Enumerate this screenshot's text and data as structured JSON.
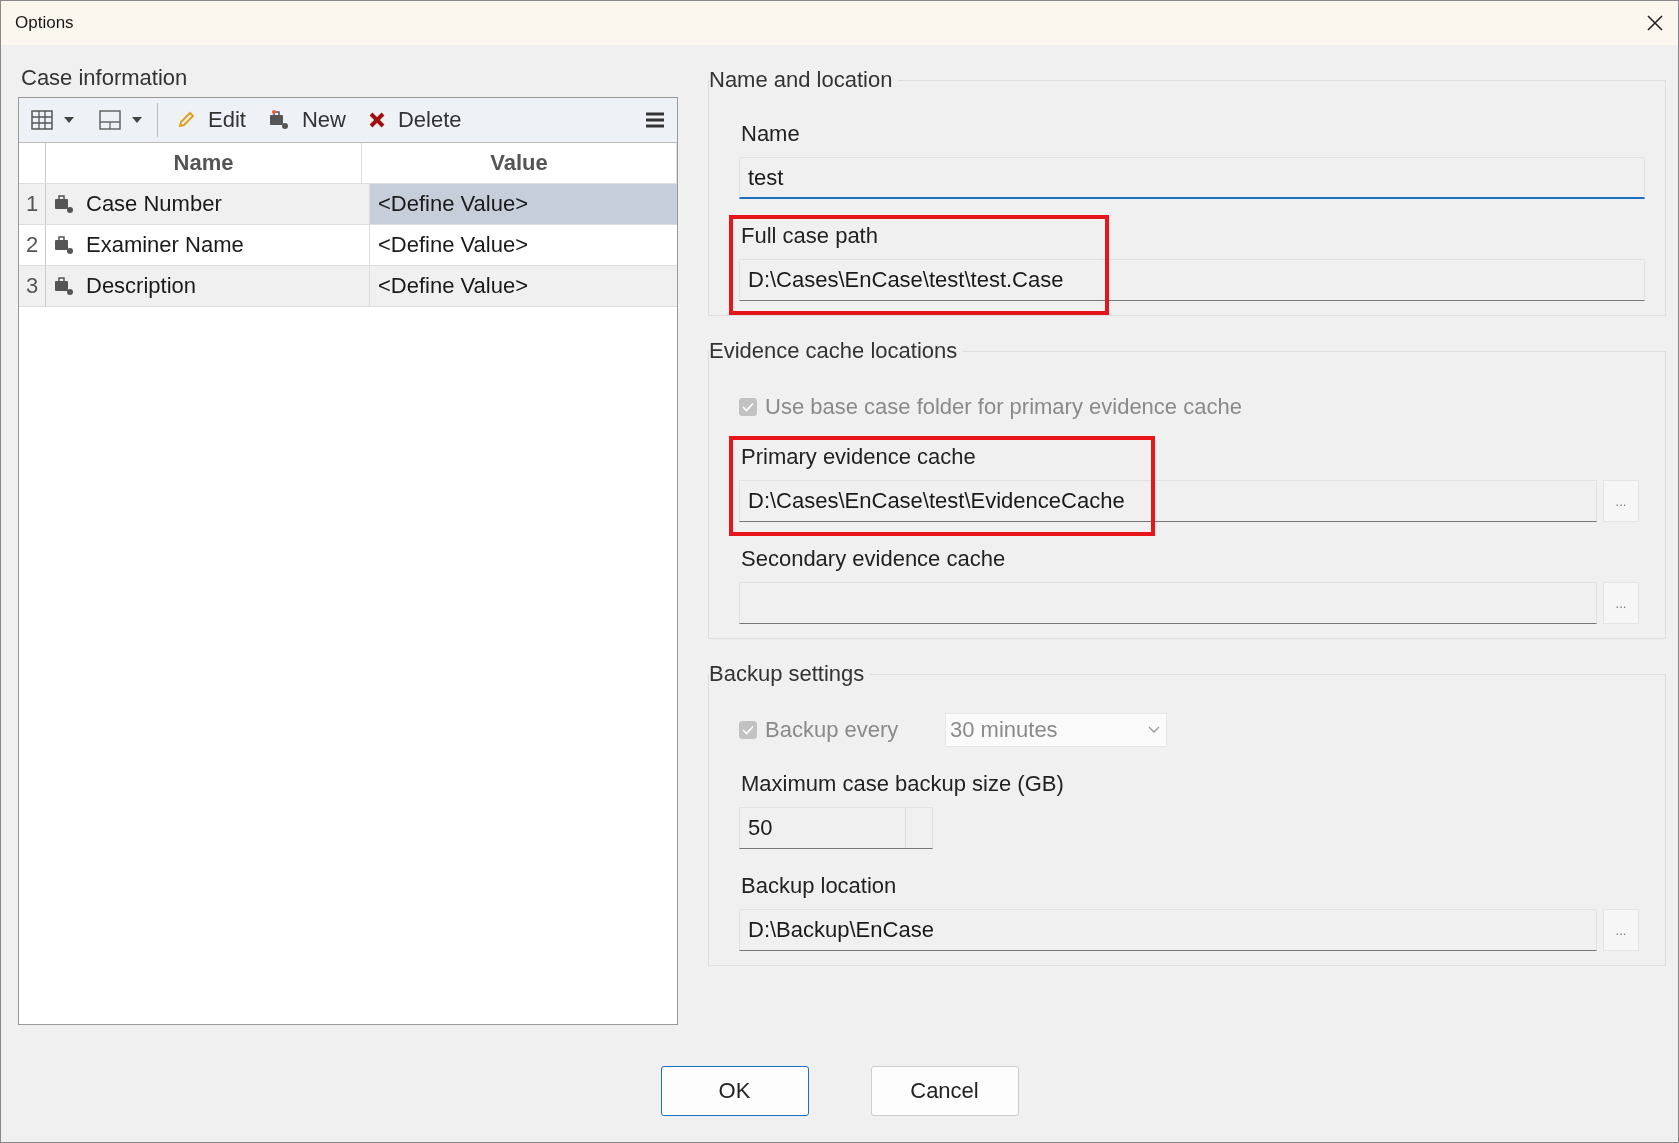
{
  "window": {
    "title": "Options"
  },
  "case_information": {
    "title": "Case information",
    "toolbar": [
      {
        "kind": "edit",
        "label": "Edit"
      },
      {
        "kind": "new",
        "label": "New"
      },
      {
        "kind": "delete",
        "label": "Delete"
      }
    ],
    "columns": [
      "Name",
      "Value"
    ],
    "rows": [
      {
        "index": "1",
        "name": "Case Number",
        "value": "<Define Value>",
        "selected": true
      },
      {
        "index": "2",
        "name": "Examiner Name",
        "value": "<Define Value>",
        "selected": false
      },
      {
        "index": "3",
        "name": "Description",
        "value": "<Define Value>",
        "selected": false
      }
    ]
  },
  "name_and_location": {
    "title": "Name and location",
    "fields": [
      {
        "label": "Name",
        "value": "test",
        "focused": true,
        "highlighted": false
      },
      {
        "label": "Full case path",
        "value": "D:\\Cases\\EnCase\\test\\test.Case",
        "focused": false,
        "highlighted": true
      }
    ]
  },
  "evidence_cache_locations": {
    "title": "Evidence cache locations",
    "checkbox": {
      "label": "Use base case folder for primary evidence cache",
      "checked": true,
      "disabled": true
    },
    "fields": [
      {
        "label": "Primary evidence cache",
        "value": "D:\\Cases\\EnCase\\test\\EvidenceCache",
        "focused": false,
        "highlighted": true,
        "browse_label": "..."
      },
      {
        "label": "Secondary evidence cache",
        "focused": false,
        "highlighted": false,
        "browse_label": "..."
      }
    ]
  },
  "backup_settings": {
    "title": "Backup settings",
    "checkbox": {
      "label": "Backup every",
      "checked": true,
      "disabled": true
    },
    "interval": {
      "value": "30 minutes",
      "disabled": true
    },
    "max_size": {
      "label": "Maximum case backup size (GB)",
      "value": "50"
    },
    "location": {
      "label": "Backup location",
      "value": "D:\\Backup\\EnCase",
      "browse_label": "..."
    }
  },
  "buttons": [
    {
      "label": "OK",
      "default": true
    },
    {
      "label": "Cancel",
      "default": false
    }
  ]
}
